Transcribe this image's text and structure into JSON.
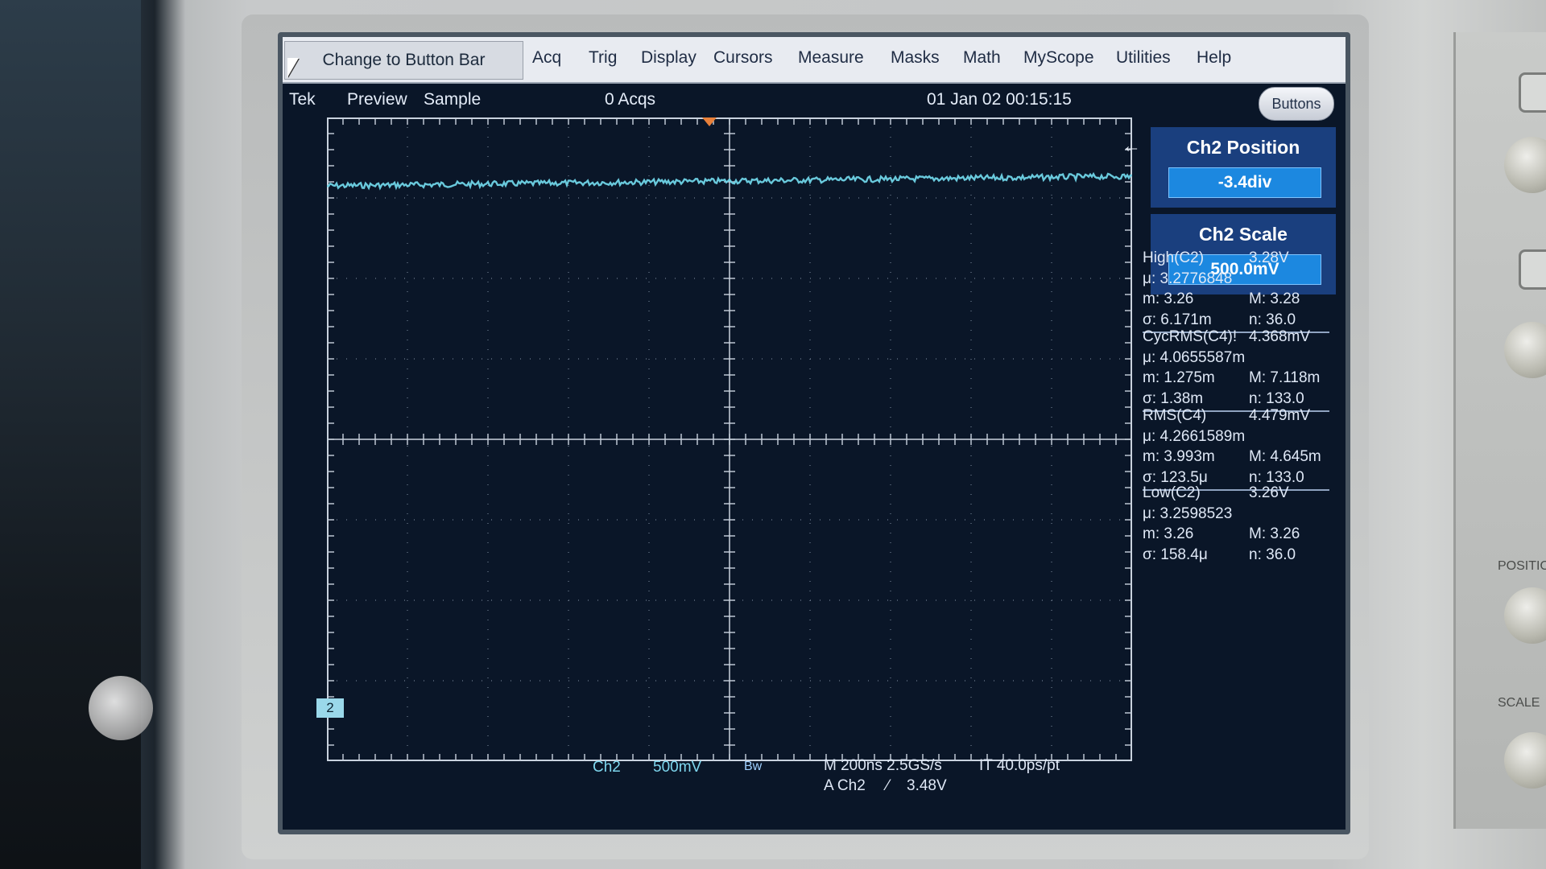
{
  "menubar": {
    "change_button": "Change to Button Bar",
    "items": [
      "Acq",
      "Trig",
      "Display",
      "Cursors",
      "Measure",
      "Masks",
      "Math",
      "MyScope",
      "Utilities",
      "Help"
    ]
  },
  "status": {
    "brand": "Tek",
    "mode": "Preview",
    "acq_mode": "Sample",
    "acqs": "0 Acqs",
    "datetime": "01 Jan 02 00:15:15",
    "buttons_label": "Buttons"
  },
  "controls": {
    "position_title": "Ch2 Position",
    "position_value": "-3.4div",
    "scale_title": "Ch2 Scale",
    "scale_value": "500.0mV"
  },
  "measurements": [
    {
      "name": "High(C2)",
      "value": "3.28V",
      "mu": "μ: 3.2776848",
      "m": "m: 3.26",
      "M": "M: 3.28",
      "sigma": "σ: 6.171m",
      "n": "n: 36.0"
    },
    {
      "name": "CycRMS(C4)!",
      "value": "4.368mV",
      "mu": "μ: 4.0655587m",
      "m": "m: 1.275m",
      "M": "M: 7.118m",
      "sigma": "σ: 1.38m",
      "n": "n: 133.0"
    },
    {
      "name": "RMS(C4)",
      "value": "4.479mV",
      "mu": "μ: 4.2661589m",
      "m": "m: 3.993m",
      "M": "M: 4.645m",
      "sigma": "σ: 123.5μ",
      "n": "n: 133.0"
    },
    {
      "name": "Low(C2)",
      "value": "3.26V",
      "mu": "μ: 3.2598523",
      "m": "m: 3.26",
      "M": "M: 3.26",
      "sigma": "σ: 158.4μ",
      "n": "n: 36.0"
    }
  ],
  "bottom": {
    "channel": "Ch2",
    "volts_div": "500mV",
    "bw": "Bw",
    "timebase": "M 200ns 2.5GS/s",
    "resolution": "IT 40.0ps/pt",
    "trigger_source": "A  Ch2",
    "trigger_slope": "⁄",
    "trigger_level": "3.48V",
    "ch2_marker": "2"
  },
  "panel_labels": {
    "position": "POSITIO",
    "scale": "SCALE"
  },
  "waveform": {
    "color": "#6fd3e6",
    "divisions_from_top": 0.85
  },
  "colors": {
    "screen": "#0a1628",
    "panel": "#1a3f7e",
    "value_box": "#1c88e0",
    "trigger": "#e8803a"
  }
}
